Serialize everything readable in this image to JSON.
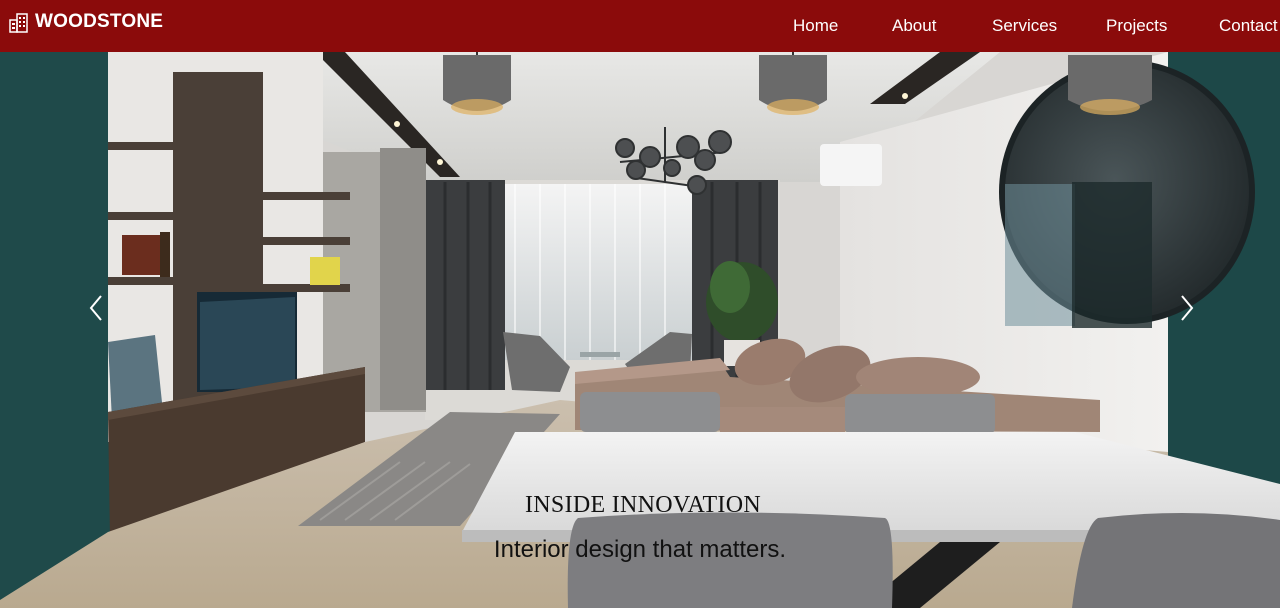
{
  "brand": {
    "name": "WOODSTONE",
    "icon": "building-icon"
  },
  "nav": {
    "items": [
      {
        "label": "Home"
      },
      {
        "label": "About"
      },
      {
        "label": "Services"
      },
      {
        "label": "Projects"
      },
      {
        "label": "Contact"
      }
    ]
  },
  "hero": {
    "title": "INSIDE INNOVATION",
    "subtitle": "Interior design that matters.",
    "prev_icon": "chevron-left-icon",
    "next_icon": "chevron-right-icon"
  },
  "colors": {
    "navbar": "#8b0b0b",
    "nav_text": "#ffffff",
    "accent_wall": "#1f4a4a"
  }
}
